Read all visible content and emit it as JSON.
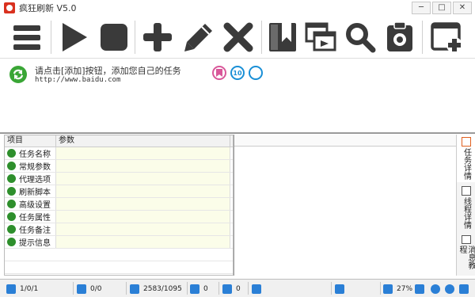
{
  "window": {
    "title": "疯狂刷新 V5.0",
    "minimize": "─",
    "maximize": "□",
    "close": "✕"
  },
  "toolbar": {
    "items": [
      {
        "name": "menu-button",
        "icon": "menu-icon"
      },
      {
        "name": "start-button",
        "icon": "play-icon"
      },
      {
        "name": "stop-button",
        "icon": "stop-icon"
      },
      {
        "name": "add-task-button",
        "icon": "plus-icon"
      },
      {
        "name": "edit-task-button",
        "icon": "pencil-icon"
      },
      {
        "name": "delete-task-button",
        "icon": "close-icon"
      },
      {
        "name": "bookmark-button",
        "icon": "bookmark-icon"
      },
      {
        "name": "window-switch-button",
        "icon": "windows-icon"
      },
      {
        "name": "search-button",
        "icon": "search-icon"
      },
      {
        "name": "settings-button",
        "icon": "clipboard-gear-icon"
      },
      {
        "name": "add-window-button",
        "icon": "window-add-icon"
      }
    ]
  },
  "task": {
    "name": "请点击[添加]按钮，添加您自己的任务",
    "url": "http://www.baidu.com",
    "badge_count": "10",
    "colors": {
      "refresh": "#3aa636",
      "bookmark": "#d9589a",
      "count": "#1a8fd6"
    }
  },
  "grid": {
    "headers": {
      "item": "项目",
      "param": "参数"
    },
    "rows": [
      {
        "label": "任务名称",
        "icon": "user-icon"
      },
      {
        "label": "常规参数",
        "icon": "list-icon"
      },
      {
        "label": "代理选项",
        "icon": "proxy-icon"
      },
      {
        "label": "刷新脚本",
        "icon": "script-icon"
      },
      {
        "label": "高级设置",
        "icon": "advanced-icon"
      },
      {
        "label": "任务属性",
        "icon": "properties-icon"
      },
      {
        "label": "任务备注",
        "icon": "note-icon"
      },
      {
        "label": "提示信息",
        "icon": "message-icon"
      }
    ]
  },
  "side_tabs": [
    {
      "label": "任务详情",
      "icon": "task-detail-icon",
      "active": true
    },
    {
      "label": "线程详情",
      "icon": "thread-detail-icon",
      "active": false
    },
    {
      "label": "消息教程",
      "icon": "message-tutorial-icon",
      "active": false
    }
  ],
  "status": {
    "tasks": "1/0/1",
    "windows": "0/0",
    "refresh": "2583/1095",
    "downloads": "0",
    "ie": "0",
    "percent": "27%"
  }
}
